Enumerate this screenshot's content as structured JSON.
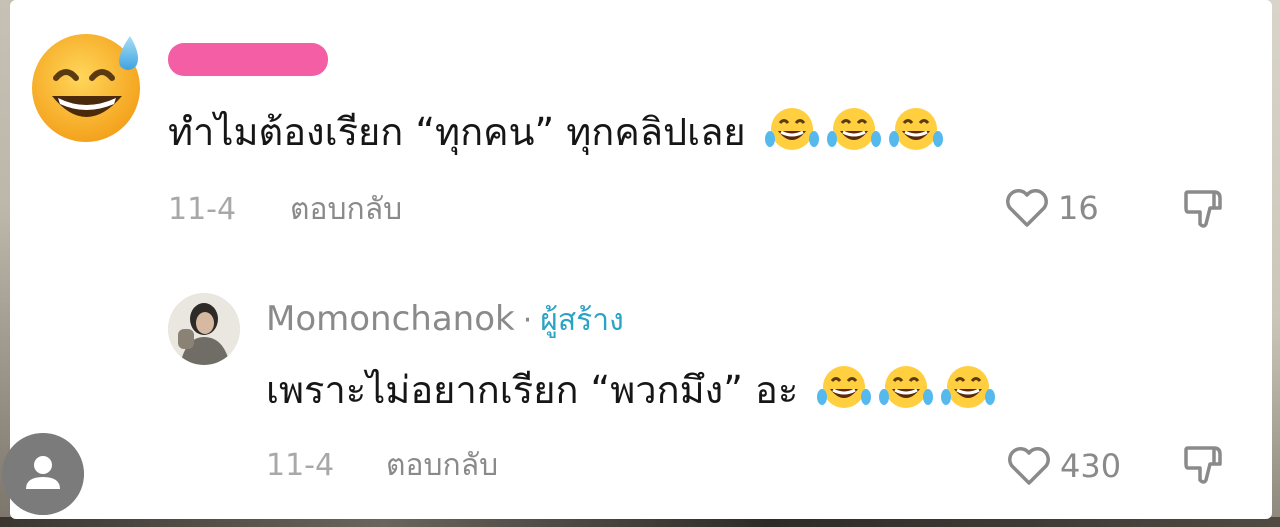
{
  "comment": {
    "text": "ทำไมต้องเรียก “ทุกคน” ทุกคลิปเลย",
    "reaction_emoji": [
      "laughing-tears-emoji",
      "laughing-tears-emoji",
      "laughing-tears-emoji"
    ],
    "avatar_icon": "grinning-sweat-emoji",
    "date": "11-4",
    "reply_label": "ตอบกลับ",
    "likes": "16"
  },
  "reply": {
    "author": "Momonchanok",
    "separator": "·",
    "creator_badge": "ผู้สร้าง",
    "text": "เพราะไม่อยากเรียก “พวกมึง” อะ",
    "reaction_emoji": [
      "laughing-tears-emoji",
      "laughing-tears-emoji",
      "laughing-tears-emoji"
    ],
    "date": "11-4",
    "reply_label": "ตอบกลับ",
    "likes": "430"
  },
  "colors": {
    "redaction": "#f35ea5",
    "creator_badge": "#2aa3c4",
    "meta_text": "#8a8a8a"
  }
}
